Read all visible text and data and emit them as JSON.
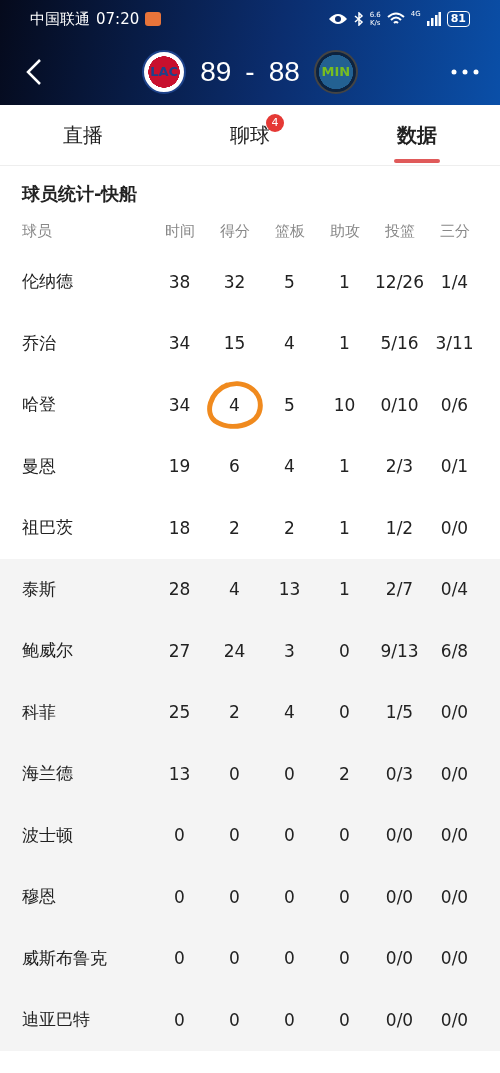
{
  "status_bar": {
    "carrier": "中国联通",
    "time": "07:20",
    "net_speed": [
      "6.6",
      "K/s"
    ],
    "network": "4G",
    "battery": "81"
  },
  "header": {
    "home": {
      "logo": "LAC",
      "score": "89"
    },
    "separator": "-",
    "away": {
      "logo": "MIN",
      "score": "88"
    }
  },
  "tabs": [
    {
      "label": "直播",
      "selected": false
    },
    {
      "label": "聊球",
      "selected": false,
      "badge": "4"
    },
    {
      "label": "数据",
      "selected": true
    }
  ],
  "section_title": "球员统计-快船",
  "columns": [
    "球员",
    "时间",
    "得分",
    "篮板",
    "助攻",
    "投篮",
    "三分"
  ],
  "starters": [
    {
      "cells": [
        "伦纳德",
        "38",
        "32",
        "5",
        "1",
        "12/26",
        "1/4"
      ],
      "circled": false
    },
    {
      "cells": [
        "乔治",
        "34",
        "15",
        "4",
        "1",
        "5/16",
        "3/11"
      ],
      "circled": false
    },
    {
      "cells": [
        "哈登",
        "34",
        "4",
        "5",
        "10",
        "0/10",
        "0/6"
      ],
      "circled": true
    },
    {
      "cells": [
        "曼恩",
        "19",
        "6",
        "4",
        "1",
        "2/3",
        "0/1"
      ],
      "circled": false
    },
    {
      "cells": [
        "祖巴茨",
        "18",
        "2",
        "2",
        "1",
        "1/2",
        "0/0"
      ],
      "circled": false
    }
  ],
  "bench": [
    {
      "cells": [
        "泰斯",
        "28",
        "4",
        "13",
        "1",
        "2/7",
        "0/4"
      ],
      "circled": false
    },
    {
      "cells": [
        "鲍威尔",
        "27",
        "24",
        "3",
        "0",
        "9/13",
        "6/8"
      ],
      "circled": false
    },
    {
      "cells": [
        "科菲",
        "25",
        "2",
        "4",
        "0",
        "1/5",
        "0/0"
      ],
      "circled": false
    },
    {
      "cells": [
        "海兰德",
        "13",
        "0",
        "0",
        "2",
        "0/3",
        "0/0"
      ],
      "circled": false
    },
    {
      "cells": [
        "波士顿",
        "0",
        "0",
        "0",
        "0",
        "0/0",
        "0/0"
      ],
      "circled": false
    },
    {
      "cells": [
        "穆恩",
        "0",
        "0",
        "0",
        "0",
        "0/0",
        "0/0"
      ],
      "circled": false
    },
    {
      "cells": [
        "威斯布鲁克",
        "0",
        "0",
        "0",
        "0",
        "0/0",
        "0/0"
      ],
      "circled": false
    },
    {
      "cells": [
        "迪亚巴特",
        "0",
        "0",
        "0",
        "0",
        "0/0",
        "0/0"
      ],
      "circled": false
    }
  ]
}
